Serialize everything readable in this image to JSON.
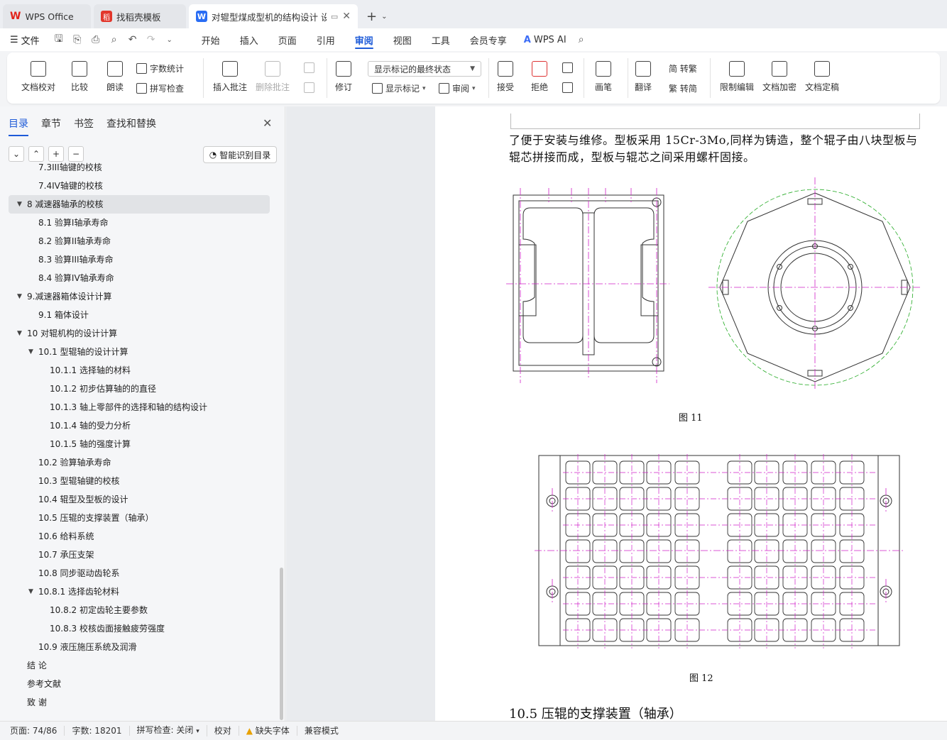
{
  "titlebar": {
    "tabs": [
      {
        "label": "WPS Office"
      },
      {
        "label": "找稻壳模板"
      },
      {
        "label": "对辊型煤成型机的结构设计 设"
      }
    ],
    "new_tab": "+"
  },
  "menubar": {
    "file": "文件",
    "tabs": [
      "开始",
      "插入",
      "页面",
      "引用",
      "审阅",
      "视图",
      "工具",
      "会员专享"
    ],
    "active": "审阅",
    "wps_ai": "WPS AI"
  },
  "ribbon": {
    "doc_check": "文档校对",
    "compare": "比较",
    "read_aloud": "朗读",
    "word_count": "字数统计",
    "spell_check": "拼写检查",
    "insert_comment": "插入批注",
    "delete_comment": "删除批注",
    "revise": "修订",
    "markup_state": "显示标记的最终状态",
    "show_markup": "显示标记",
    "review": "审阅",
    "accept": "接受",
    "reject": "拒绝",
    "pen": "画笔",
    "translate": "翻译",
    "to_traditional": "简 转繁",
    "to_simplified": "繁 转简",
    "restrict_edit": "限制编辑",
    "encrypt": "文档加密",
    "finalize": "文档定稿"
  },
  "leftpanel": {
    "tabs": [
      "目录",
      "章节",
      "书签",
      "查找和替换"
    ],
    "smart_toc": "智能识别目录",
    "toc": [
      {
        "text": "7.3III轴键的校核",
        "level": 2
      },
      {
        "text": "7.4IV轴键的校核",
        "level": 2
      },
      {
        "text": "8  减速器轴承的校核",
        "level": 1,
        "arrow": true,
        "selected": true
      },
      {
        "text": "8.1 验算I轴承寿命",
        "level": 2
      },
      {
        "text": "8.2 验算II轴承寿命",
        "level": 2
      },
      {
        "text": "8.3 验算III轴承寿命",
        "level": 2
      },
      {
        "text": "8.4 验算IV轴承寿命",
        "level": 2
      },
      {
        "text": "9.减速器箱体设计计算",
        "level": 1,
        "arrow": true
      },
      {
        "text": "9.1  箱体设计",
        "level": 2
      },
      {
        "text": "10  对辊机构的设计计算",
        "level": 1,
        "arrow": true
      },
      {
        "text": "10.1 型辊轴的设计计算",
        "level": 2,
        "arrow": true
      },
      {
        "text": "10.1.1 选择轴的材料",
        "level": 3
      },
      {
        "text": "10.1.2 初步估算轴的的直径",
        "level": 3
      },
      {
        "text": "10.1.3 轴上零部件的选择和轴的结构设计",
        "level": 3
      },
      {
        "text": "10.1.4  轴的受力分析",
        "level": 3
      },
      {
        "text": "10.1.5 轴的强度计算",
        "level": 3
      },
      {
        "text": "10.2 验算轴承寿命",
        "level": 2
      },
      {
        "text": "10.3 型辊轴键的校核",
        "level": 2
      },
      {
        "text": "10.4 辊型及型板的设计",
        "level": 2
      },
      {
        "text": "10.5  压辊的支撑装置（轴承）",
        "level": 2
      },
      {
        "text": "10.6  给料系统",
        "level": 2
      },
      {
        "text": "10.7  承压支架",
        "level": 2
      },
      {
        "text": "10.8  同步驱动齿轮系",
        "level": 2
      },
      {
        "text": "10.8.1 选择齿轮材料",
        "level": 2,
        "arrow": true
      },
      {
        "text": "10.8.2 初定齿轮主要参数",
        "level": 3
      },
      {
        "text": "10.8.3 校核齿面接触疲劳强度",
        "level": 3
      },
      {
        "text": "10.9 液压施压系统及润滑",
        "level": 2
      },
      {
        "text": "结      论",
        "level": 1
      },
      {
        "text": "参考文献",
        "level": 1
      },
      {
        "text": "致      谢",
        "level": 1
      }
    ]
  },
  "document": {
    "paragraph": "了便于安装与维修。型板采用 15Cr-3Mo,同样为铸造，整个辊子由八块型板与辊芯拼接而成，型板与辊芯之间采用螺杆固接。",
    "figure11_caption": "图    11",
    "figure12_caption": "图    12",
    "heading": "10.5  压辊的支撑装置（轴承）"
  },
  "statusbar": {
    "page": "页面: 74/86",
    "words": "字数: 18201",
    "spell": "拼写检查: 关闭",
    "proofread": "校对",
    "missing_font": "缺失字体",
    "compat": "兼容模式"
  }
}
